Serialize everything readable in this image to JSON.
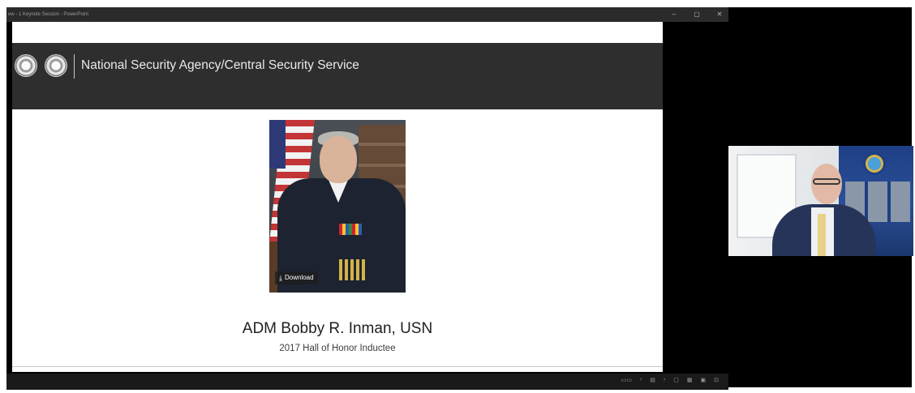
{
  "window": {
    "title": "ew - 1 Keynote Session - PowerPoint",
    "controls": [
      "–",
      "▢",
      "✕"
    ]
  },
  "slide": {
    "agency_name": "National Security Agency/Central Security Service",
    "photo_button": "Download",
    "inductee_name": "ADM Bobby R. Inman, USN",
    "inductee_title": "2017 Hall of Honor Inductee"
  },
  "statusbar": {
    "icons": [
      "display-settings-icon",
      "prev-icon",
      "notes-icon",
      "next-icon",
      "normal-view-icon",
      "slide-sorter-icon",
      "reading-view-icon",
      "fit-icon"
    ]
  }
}
